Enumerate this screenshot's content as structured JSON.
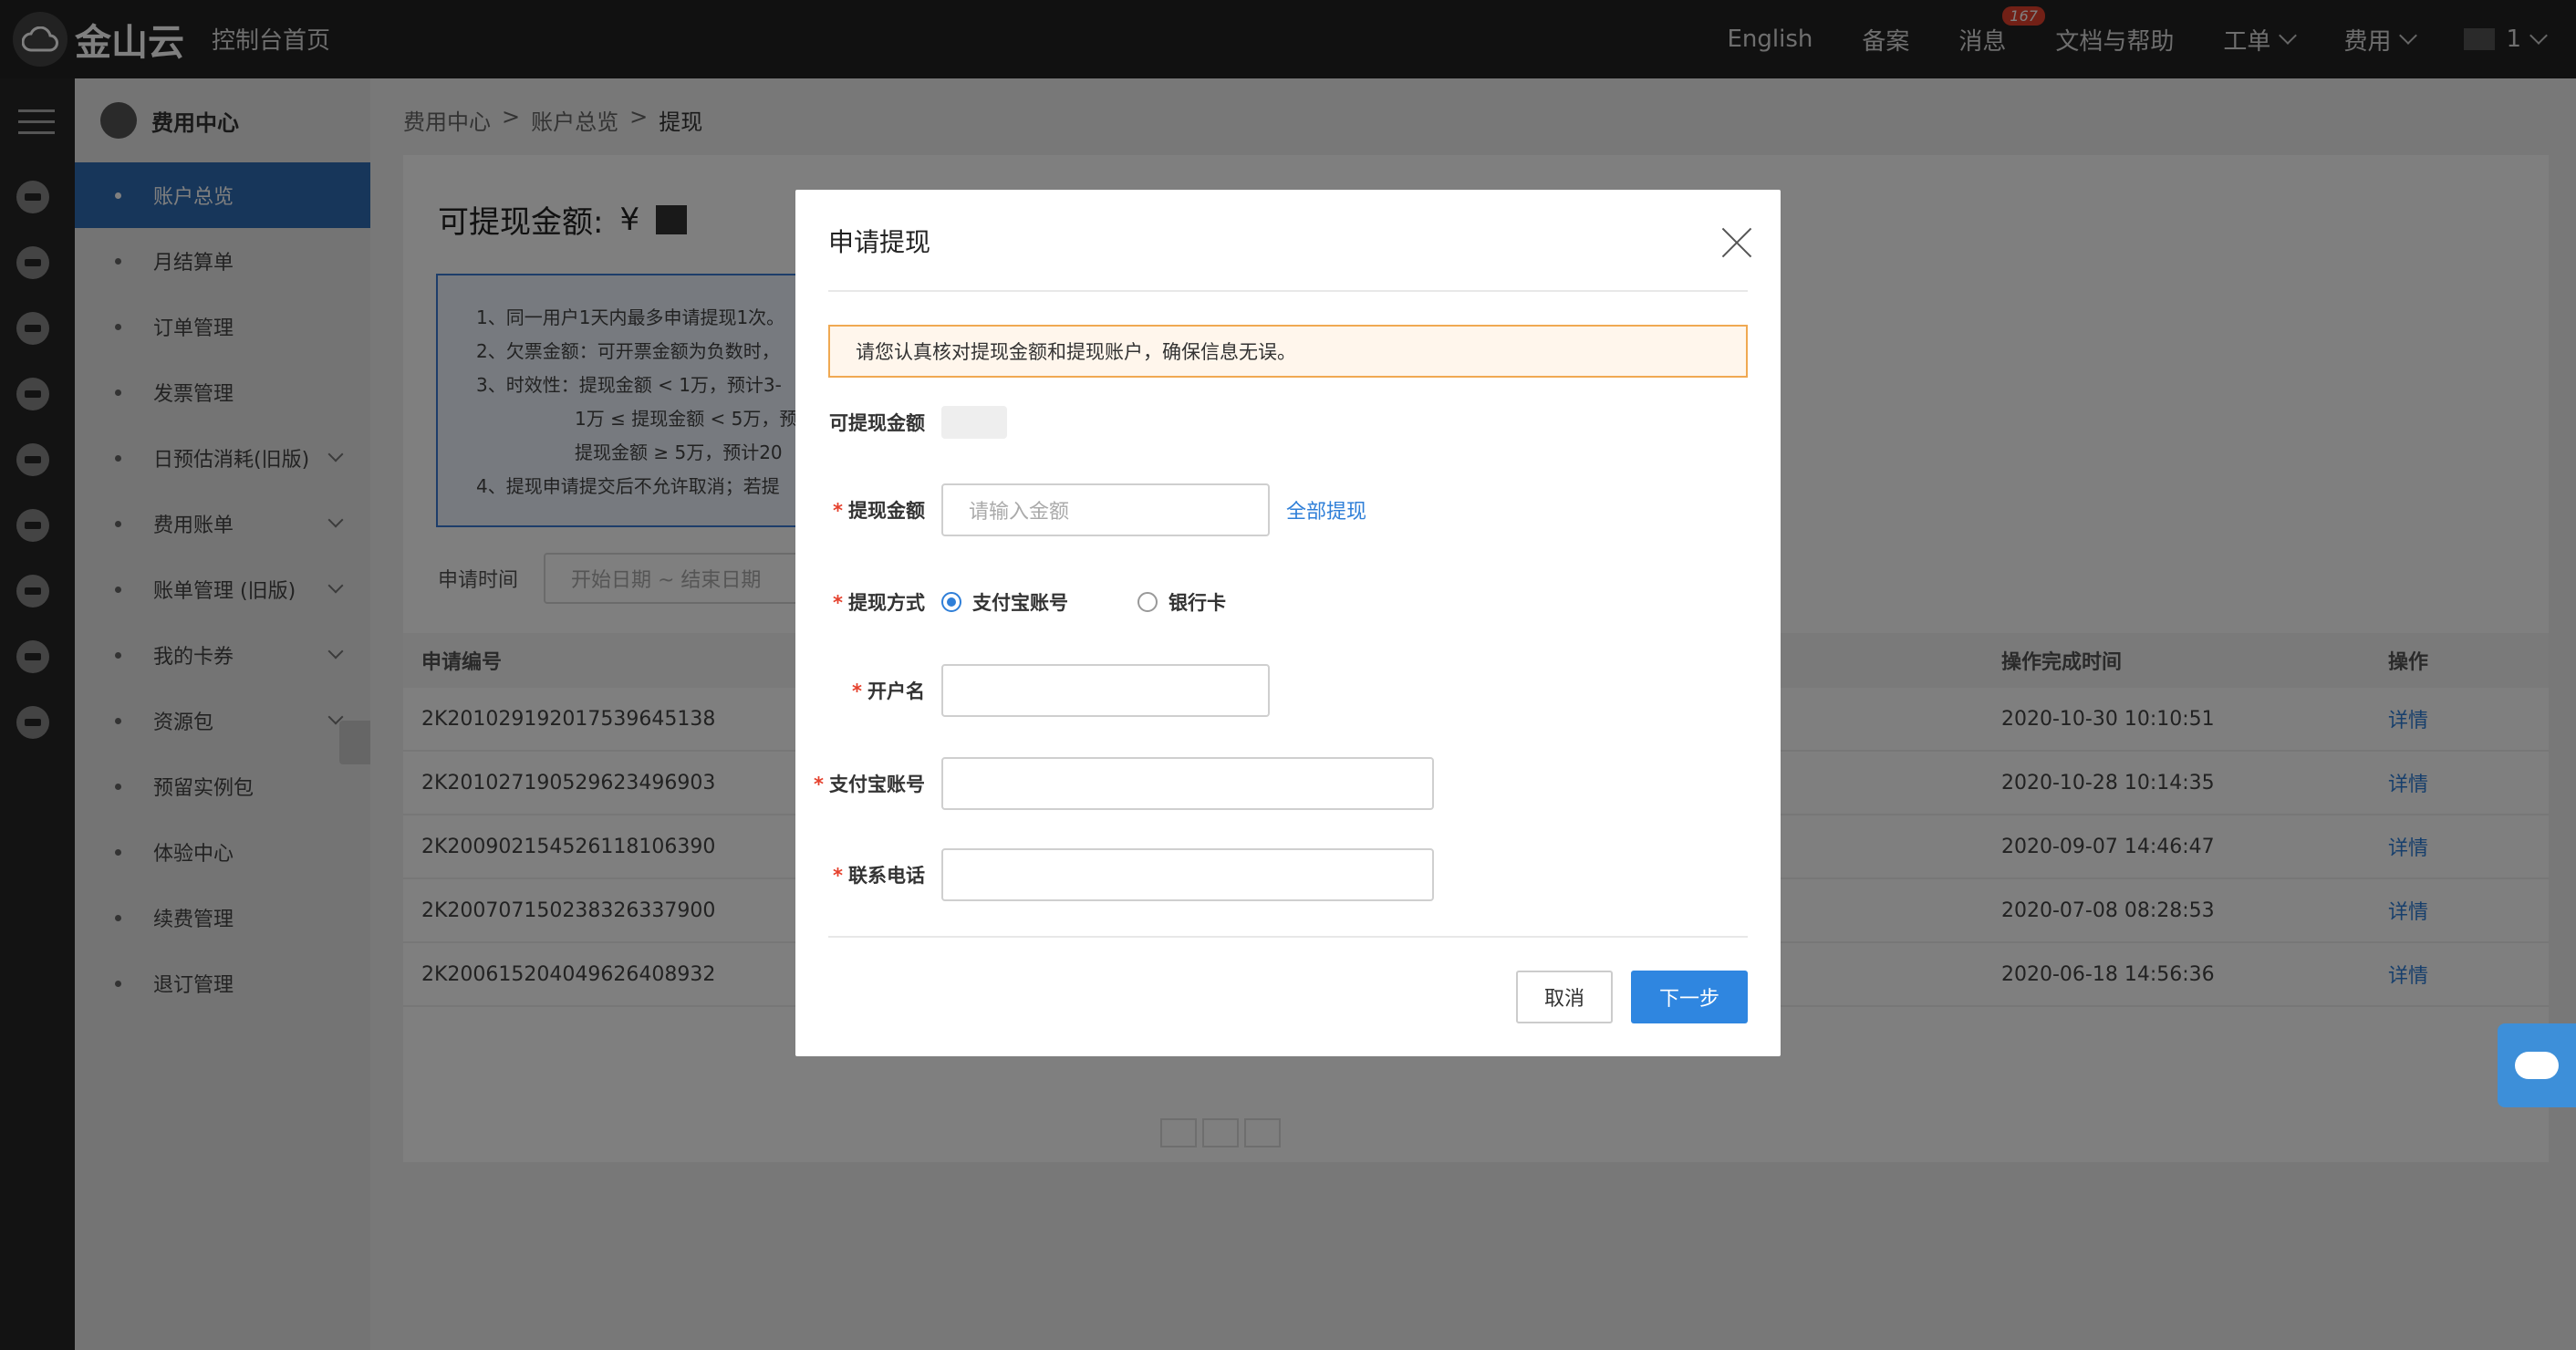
{
  "topbar": {
    "logo_text": "金山云",
    "console_home": "控制台首页",
    "nav": [
      "English",
      "备案",
      "消息",
      "文档与帮助",
      "工单",
      "费用"
    ],
    "message_badge": "167",
    "user_suffix": "1"
  },
  "sidebar": {
    "title": "费用中心",
    "items": [
      "账户总览",
      "月结算单",
      "订单管理",
      "发票管理",
      "日预估消耗(旧版)",
      "费用账单",
      "账单管理 (旧版)",
      "我的卡券",
      "资源包",
      "预留实例包",
      "体验中心",
      "续费管理",
      "退订管理"
    ],
    "active_index": 0
  },
  "breadcrumb": [
    "费用中心",
    "账户总览",
    "提现"
  ],
  "main": {
    "cash_title": "可提现金额:",
    "currency": "¥",
    "notice_lines": [
      "1、同一用户1天内最多申请提现1次。",
      "2、欠票金额：可开票金额为负数时，",
      "3、时效性：提现金额 < 1万，预计3-",
      "1万 ≤ 提现金额 < 5万，预",
      "提现金额 ≥ 5万，预计20",
      "4、提现申请提交后不允许取消；若提"
    ],
    "filter_label": "申请时间",
    "date_placeholder": "开始日期 ~ 结束日期",
    "columns": [
      "申请编号",
      "操作完成时间",
      "操作"
    ],
    "rows": [
      {
        "id": "2K20102919201753964513​8",
        "time": "2020-10-30 10:10:51",
        "op": "详情"
      },
      {
        "id": "2K201027190529623496903",
        "time": "2020-10-28 10:14:35",
        "op": "详情"
      },
      {
        "id": "2K200902154526118106390",
        "time": "2020-09-07 14:46:47",
        "op": "详情"
      },
      {
        "id": "2K200707150238326337900",
        "time": "2020-07-08 08:28:53",
        "op": "详情"
      },
      {
        "id": "2K200615204049626408932",
        "time": "2020-06-18 14:56:36",
        "op": "详情"
      }
    ]
  },
  "modal": {
    "title": "申请提现",
    "warning": "请您认真核对提现金额和提现账户，确保信息无误。",
    "available_label": "可提现金额",
    "amount_label": "提现金额",
    "amount_placeholder": "请输入金额",
    "withdraw_all": "全部提现",
    "method_label": "提现方式",
    "method_alipay": "支付宝账号",
    "method_bank": "银行卡",
    "name_label": "开户名",
    "alipay_label": "支付宝账号",
    "phone_label": "联系电话",
    "cancel": "取消",
    "next": "下一步"
  }
}
